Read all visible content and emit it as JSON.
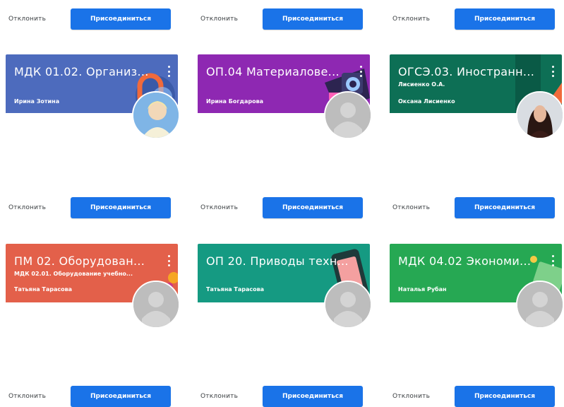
{
  "buttons": {
    "decline_label": "Отклонить",
    "join_label": "Присоединиться"
  },
  "cards": [
    {
      "title": "МДК 01.02. Организ...",
      "subtitle": "",
      "teacher": "Ирина Зотина",
      "color": "#4d6bbd"
    },
    {
      "title": "ОП.04 Материалове...",
      "subtitle": "",
      "teacher": "Ирина Богдарова",
      "color": "#8e28b2"
    },
    {
      "title": "ОГСЭ.03. Иностранн...",
      "subtitle": "Лисиенко О.А.",
      "teacher": "Оксана Лисиенко",
      "color": "#0d6f55"
    },
    {
      "title": "ПМ 02. Оборудован...",
      "subtitle": "МДК 02.01. Оборудование учебно...",
      "teacher": "Татьяна Тарасова",
      "color": "#e3604a"
    },
    {
      "title": "ОП 20. Приводы техн...",
      "subtitle": "",
      "teacher": "Татьяна Тарасова",
      "color": "#159a82"
    },
    {
      "title": "МДК 04.02 Экономи...",
      "subtitle": "",
      "teacher": "Наталья Рубан",
      "color": "#26a853"
    }
  ],
  "colors": {
    "join_button": "#1a73e8",
    "avatar_placeholder": "#bdbdbd"
  }
}
